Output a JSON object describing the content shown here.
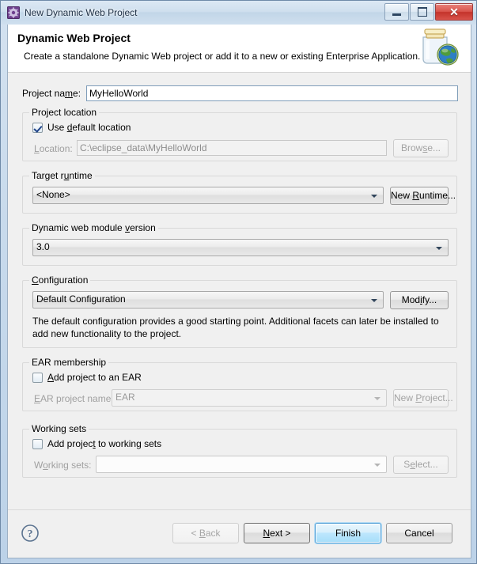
{
  "window": {
    "title": "New Dynamic Web Project",
    "icon": "eclipse-project-gear-icon",
    "minimize_label": "Minimize",
    "maximize_label": "Maximize",
    "close_label": "Close",
    "close_glyph": "✕"
  },
  "banner": {
    "title": "Dynamic Web Project",
    "description": "Create a standalone Dynamic Web project or add it to a new or existing Enterprise Application.",
    "image": "jar-with-globe-icon"
  },
  "form": {
    "project_name": {
      "label_before": "Project na",
      "label_mnemonic": "m",
      "label_after": "e:",
      "value": "MyHelloWorld"
    },
    "project_location": {
      "group_label": "Project location",
      "use_default": {
        "label_before": "Use ",
        "label_mnemonic": "d",
        "label_after": "efault location",
        "checked": true
      },
      "location": {
        "label_mnemonic": "L",
        "label_after": "ocation:",
        "value": "C:\\eclipse_data\\MyHelloWorld",
        "enabled": false
      },
      "browse_button": {
        "label_before": "Brow",
        "label_mnemonic": "s",
        "label_after": "e...",
        "enabled": false
      }
    },
    "target_runtime": {
      "group_label_before": "Target r",
      "group_label_mnemonic": "u",
      "group_label_after": "ntime",
      "value": "<None>",
      "new_runtime_button": {
        "label_before": "New ",
        "label_mnemonic": "R",
        "label_after": "untime..."
      }
    },
    "module_version": {
      "group_label_before": "Dynamic web module ",
      "group_label_mnemonic": "v",
      "group_label_after": "ersion",
      "value": "3.0"
    },
    "configuration": {
      "group_label_mnemonic": "C",
      "group_label_after": "onfiguration",
      "value": "Default Configuration",
      "modify_button": {
        "label_before": "Mod",
        "label_mnemonic": "i",
        "label_after": "fy..."
      },
      "description_line1": "The default configuration provides a good starting point. Additional facets can later be installed to add",
      "description_line2": "new functionality to the project."
    },
    "ear_membership": {
      "group_label": "EAR membership",
      "add_to_ear": {
        "label_mnemonic": "A",
        "label_after": "dd project to an EAR",
        "checked": false
      },
      "ear_project_name": {
        "label_mnemonic": "E",
        "label_after": "AR project name:",
        "value": "EAR",
        "enabled": false
      },
      "new_project_button": {
        "label_before": "New ",
        "label_mnemonic": "P",
        "label_after": "roject...",
        "enabled": false
      }
    },
    "working_sets": {
      "group_label": "Working sets",
      "add_to_working_sets": {
        "label_before": "Add projec",
        "label_mnemonic": "t",
        "label_after": " to working sets",
        "checked": false
      },
      "working_sets_field": {
        "label_before": "W",
        "label_mnemonic": "o",
        "label_after": "rking sets:",
        "value": "",
        "enabled": false
      },
      "select_button": {
        "label_before": "S",
        "label_mnemonic": "e",
        "label_after": "lect...",
        "enabled": false
      }
    }
  },
  "footer": {
    "help_icon": "question-mark-icon",
    "back_button": {
      "label_before": "< ",
      "label_mnemonic": "B",
      "label_after": "ack",
      "enabled": false
    },
    "next_button": {
      "label_before": "",
      "label_mnemonic": "N",
      "label_after": "ext >",
      "enabled": true
    },
    "finish_button": {
      "label": "Finish",
      "enabled": true,
      "default": true
    },
    "cancel_button": {
      "label": "Cancel",
      "enabled": true
    }
  },
  "colors": {
    "window_frame": "#bcd2e8",
    "dialog_background": "#f0f0f0",
    "banner_background": "#ffffff",
    "focus_blue": "#4a9bd4",
    "close_red": "#c4332b",
    "text": "#000000",
    "disabled_text": "#a0a0a0"
  }
}
